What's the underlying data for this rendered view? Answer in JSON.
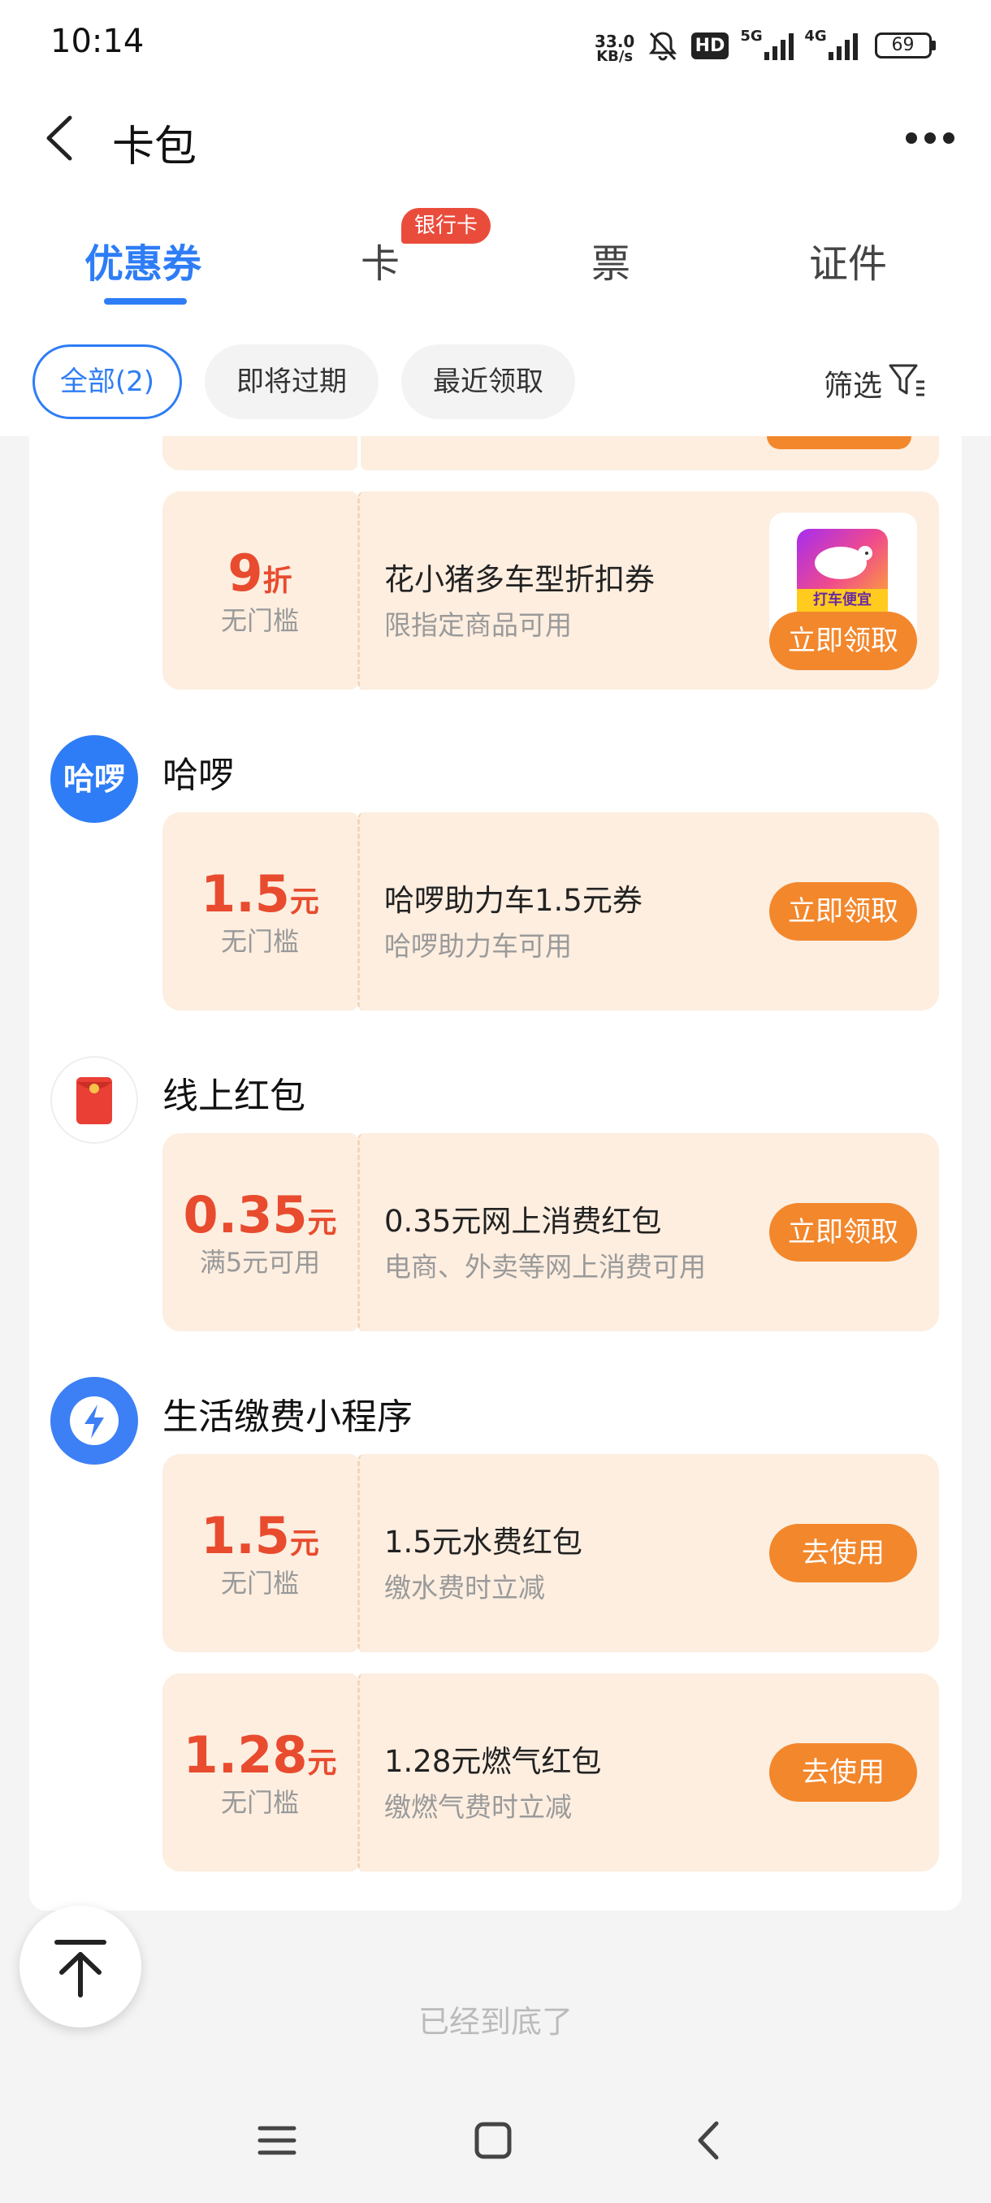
{
  "status_bar": {
    "time": "10:14",
    "net_speed_top": "33.0",
    "net_speed_bottom": "KB/s",
    "hd_label": "HD",
    "signal_5g": "5G",
    "signal_4g": "4G",
    "battery": "69",
    "icons": [
      "bell-off-icon",
      "signal-icon",
      "battery-icon"
    ]
  },
  "header": {
    "title": "卡包",
    "icons": [
      "back-arrow-icon",
      "more-dots-icon"
    ]
  },
  "tabs": [
    {
      "label": "优惠券",
      "active": true
    },
    {
      "label": "卡",
      "badge": "银行卡",
      "active": false
    },
    {
      "label": "票",
      "active": false
    },
    {
      "label": "证件",
      "active": false
    }
  ],
  "filters": {
    "chips": [
      {
        "label": "全部(2)",
        "selected": true
      },
      {
        "label": "即将过期",
        "selected": false
      },
      {
        "label": "最近领取",
        "selected": false
      }
    ],
    "filter_label": "筛选"
  },
  "groups": [
    {
      "merchant": "",
      "coupons": [
        {
          "value": "9",
          "unit": "折",
          "condition": "无门槛",
          "title": "花小猪多车型折扣券",
          "subtitle": "限指定商品可用",
          "button": "立即领取",
          "thumbnail_text": "打车便宜"
        }
      ]
    },
    {
      "merchant": "哈啰",
      "logo_text": "哈啰",
      "coupons": [
        {
          "value": "1.5",
          "unit": "元",
          "condition": "无门槛",
          "title": "哈啰助力车1.5元券",
          "subtitle": "哈啰助力车可用",
          "button": "立即领取"
        }
      ]
    },
    {
      "merchant": "线上红包",
      "coupons": [
        {
          "value": "0.35",
          "unit": "元",
          "condition": "满5元可用",
          "title": "0.35元网上消费红包",
          "subtitle": "电商、外卖等网上消费可用",
          "button": "立即领取"
        }
      ]
    },
    {
      "merchant": "生活缴费小程序",
      "coupons": [
        {
          "value": "1.5",
          "unit": "元",
          "condition": "无门槛",
          "title": "1.5元水费红包",
          "subtitle": "缴水费时立减",
          "button": "去使用"
        },
        {
          "value": "1.28",
          "unit": "元",
          "condition": "无门槛",
          "title": "1.28元燃气红包",
          "subtitle": "缴燃气费时立减",
          "button": "去使用"
        }
      ]
    }
  ],
  "footer": {
    "end_text": "已经到底了"
  },
  "colors": {
    "accent_blue": "#2e7df6",
    "coupon_bg": "#fdeee0",
    "value_red": "#e84b2e",
    "button_orange": "#f3872c",
    "badge_red": "#ea4c3b"
  }
}
